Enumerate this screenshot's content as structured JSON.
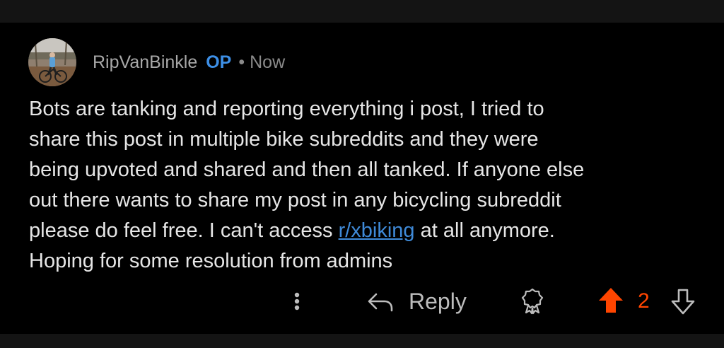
{
  "comment": {
    "author": "RipVanBinkle",
    "badge": "OP",
    "separator": "•",
    "time": "Now",
    "body_lines": {
      "line1": "Bots are tanking and reporting everything i post, I tried to",
      "line2": "share this post in multiple bike subreddits and they were",
      "line3": "being upvoted and shared and then all tanked. If anyone else",
      "line4": "out there wants to share my post in any bicycling subreddit",
      "line5_before": "please do feel free. I can't access ",
      "line5_link": "r/xbiking",
      "line5_after": " at all anymore.",
      "line6": "Hoping for some resolution from admins"
    },
    "avatar_icon": "avatar-photo-cyclist"
  },
  "actions": {
    "more_icon": "kebab-vertical-icon",
    "reply_label": "Reply",
    "reply_icon": "reply-arrow-icon",
    "award_icon": "award-icon",
    "upvote_icon": "upvote-arrow-icon",
    "score": "2",
    "downvote_icon": "downvote-arrow-icon"
  },
  "colors": {
    "background": "#000000",
    "username": "#a8a8a8",
    "op_badge": "#3d8fe6",
    "link": "#3f8ad8",
    "upvote_active": "#ff4500",
    "body_text": "#e6e6e6"
  }
}
